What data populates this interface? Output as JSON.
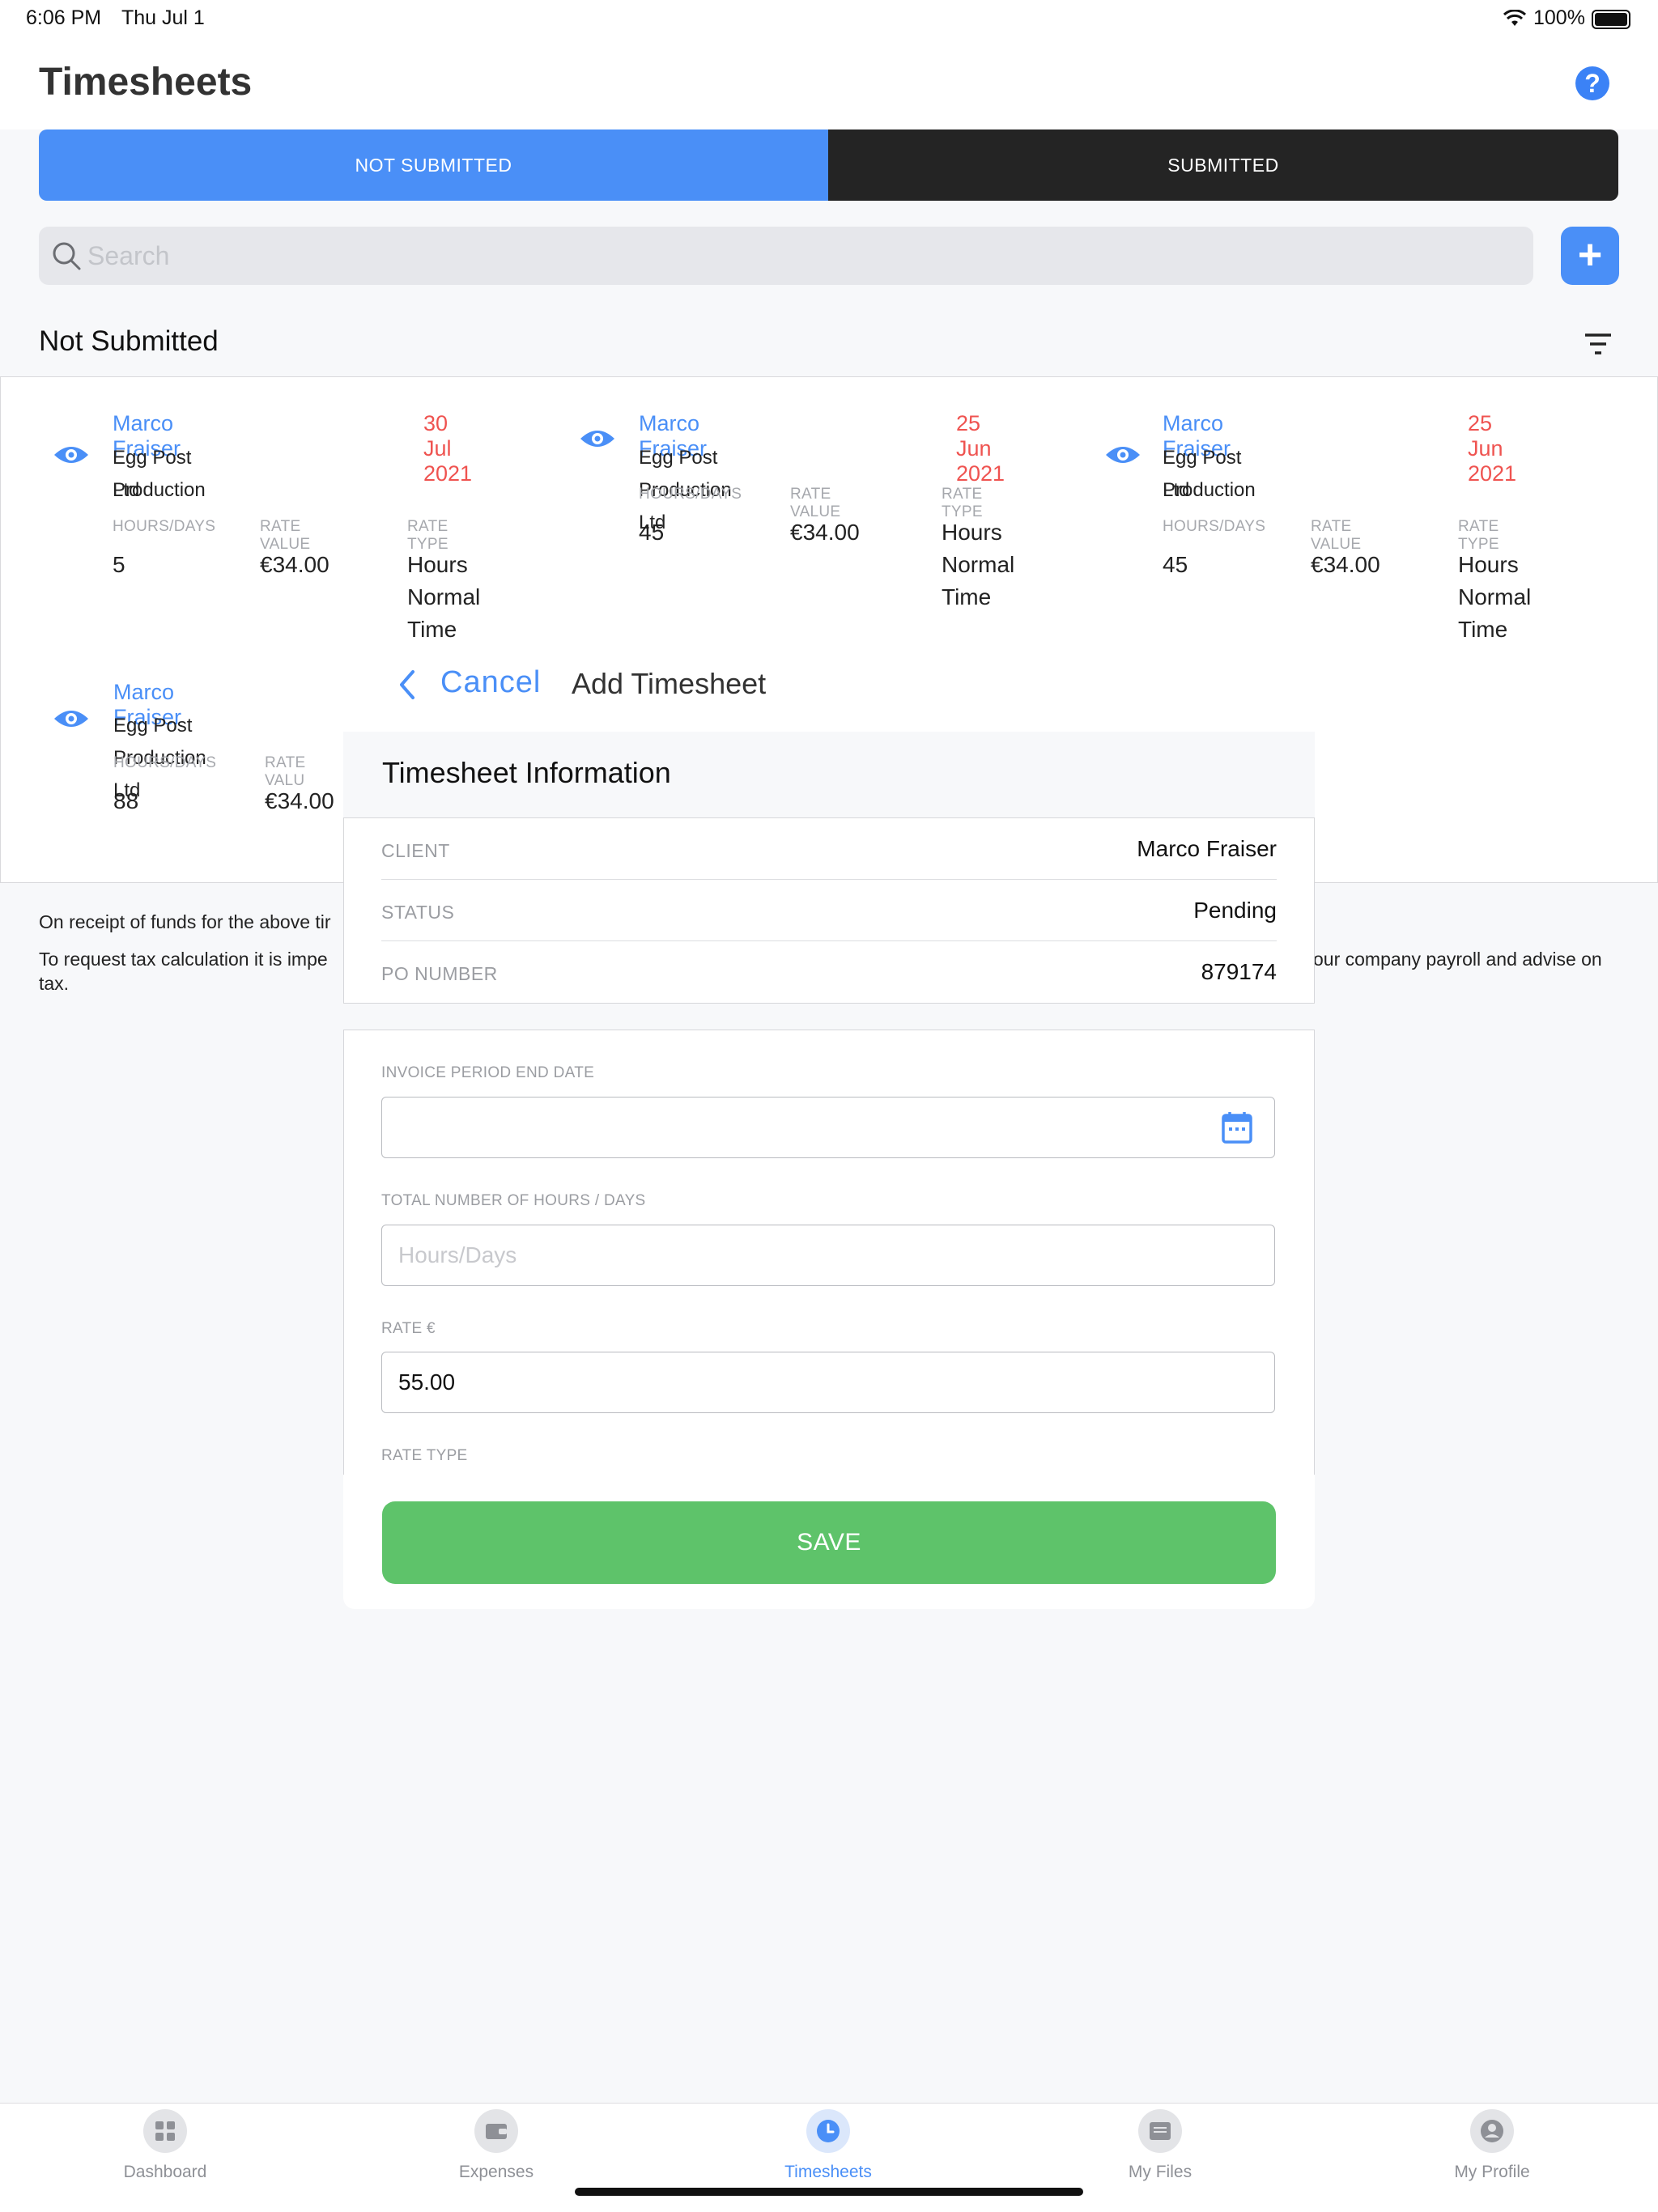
{
  "status_bar": {
    "time": "6:06 PM",
    "date": "Thu Jul 1",
    "battery": "100%"
  },
  "header": {
    "title": "Timesheets"
  },
  "segments": {
    "not_submitted": "NOT SUBMITTED",
    "submitted": "SUBMITTED"
  },
  "search": {
    "placeholder": "Search"
  },
  "section": {
    "title": "Not Submitted"
  },
  "cards": [
    {
      "name": "Marco Fraiser",
      "date": "30 Jul 2021",
      "company_l1": "Egg Post Production",
      "company_l2": "Ltd",
      "hours_label": "HOURS/DAYS",
      "rate_label": "RATE VALUE",
      "type_label": "RATE TYPE",
      "hours": "5",
      "rate": "€34.00",
      "type_l1": "Hours",
      "type_l2": "Normal Time"
    },
    {
      "name": "Marco Fraiser",
      "date": "25 Jun 2021",
      "company_l1": "Egg Post Production Ltd",
      "hours_label": "HOURS/DAYS",
      "rate_label": "RATE VALUE",
      "type_label": "RATE TYPE",
      "hours": "45",
      "rate": "€34.00",
      "type_l1": "Hours",
      "type_l2": "Normal Time"
    },
    {
      "name": "Marco Fraiser",
      "date": "25 Jun 2021",
      "company_l1": "Egg Post Production",
      "company_l2": "Ltd",
      "hours_label": "HOURS/DAYS",
      "rate_label": "RATE VALUE",
      "type_label": "RATE TYPE",
      "hours": "45",
      "rate": "€34.00",
      "type_l1": "Hours",
      "type_l2": "Normal Time"
    },
    {
      "name": "Marco Fraiser",
      "company_l1": "Egg Post Production Ltd",
      "hours_label": "HOURS/DAYS",
      "rate_label": "RATE VALU",
      "hours": "88",
      "rate": "€34.00"
    }
  ],
  "notes": {
    "line1": "On receipt of funds for the above tir",
    "line2_left": "To request tax calculation it is impe",
    "line2_right": "our company payroll and advise on",
    "line3": "tax."
  },
  "modal": {
    "cancel": "Cancel",
    "title": "Add Timesheet",
    "info_title": "Timesheet Information",
    "rows": [
      {
        "label": "CLIENT",
        "value": "Marco Fraiser"
      },
      {
        "label": "STATUS",
        "value": "Pending"
      },
      {
        "label": "PO NUMBER",
        "value": "879174"
      }
    ],
    "form": {
      "invoice_label": "INVOICE PERIOD END DATE",
      "hours_label": "TOTAL NUMBER OF HOURS / DAYS",
      "hours_placeholder": "Hours/Days",
      "rate_label": "RATE €",
      "rate_value": "55.00",
      "rate_type_label": "RATE TYPE"
    },
    "save": "SAVE"
  },
  "tabbar": [
    {
      "label": "Dashboard"
    },
    {
      "label": "Expenses"
    },
    {
      "label": "Timesheets"
    },
    {
      "label": "My Files"
    },
    {
      "label": "My Profile"
    }
  ],
  "colors": {
    "accent": "#4a8ff7",
    "date_red": "#ef5350",
    "save_green": "#5ec36a",
    "dark_segment": "#242424"
  }
}
